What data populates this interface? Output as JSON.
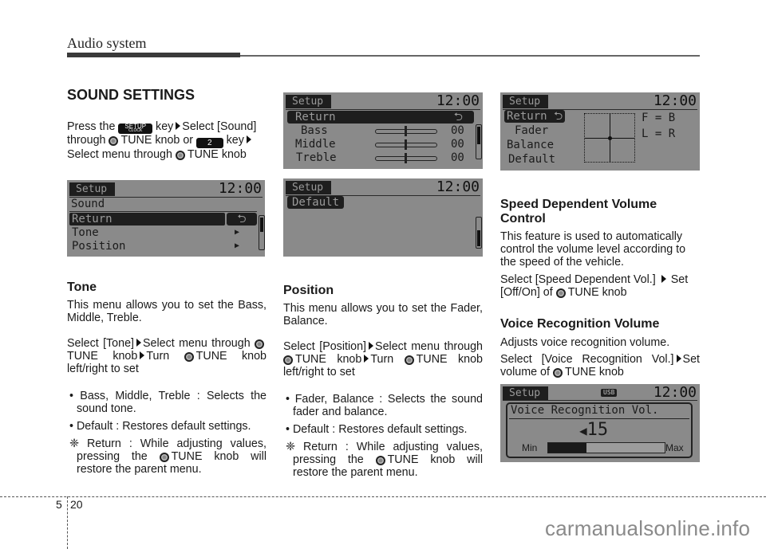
{
  "header": {
    "title": "Audio system"
  },
  "col1": {
    "heading": "SOUND SETTINGS",
    "intro": {
      "t1": "Press the",
      "key_setup": "SETUP",
      "key_setup_sub": "CLOCK",
      "t2": "key",
      "t3": "Select [Sound]",
      "t4": "through",
      "t5": "TUNE knob or",
      "key_2": "2",
      "t6": "key",
      "t7": "Select menu through",
      "t8": "TUNE knob"
    },
    "screen": {
      "tab": "Setup",
      "clock": "12:00",
      "title": "Sound",
      "items": [
        {
          "label": "Return",
          "icon": "return-icon",
          "selected": true
        },
        {
          "label": "Tone",
          "icon": "arrow-right-icon",
          "selected": false
        },
        {
          "label": "Position",
          "icon": "arrow-right-icon",
          "selected": false
        }
      ]
    },
    "tone": {
      "heading": "Tone",
      "desc": "This menu allows you to set the Bass, Middle, Treble.",
      "s1": "Select [Tone]",
      "s2": "Select menu through",
      "s3": "TUNE knob",
      "s4": "Turn",
      "s5": "TUNE knob left/right to set",
      "bullets": [
        "Bass, Middle, Treble : Selects the sound tone.",
        "Default : Restores default settings."
      ],
      "note_sym": "❈",
      "note1": "Return : While adjusting values, pressing the",
      "note2": "TUNE knob will restore the parent menu."
    }
  },
  "col2": {
    "screen_tone": {
      "tab": "Setup",
      "clock": "12:00",
      "return_label": "Return",
      "rows": [
        {
          "label": "Bass",
          "value": "00",
          "level": 0.5
        },
        {
          "label": "Middle",
          "value": "00",
          "level": 0.5
        },
        {
          "label": "Treble",
          "value": "00",
          "level": 0.5
        }
      ]
    },
    "screen_default": {
      "tab": "Setup",
      "clock": "12:00",
      "item": "Default"
    },
    "position": {
      "heading": "Position",
      "desc": "This menu allows you to set the Fader, Balance.",
      "s1": "Select [Position]",
      "s2": "Select menu through",
      "s3": "TUNE knob",
      "s4": "Turn",
      "s5": "TUNE knob left/right to set",
      "bullets": [
        "Fader, Balance : Selects the sound fader and balance.",
        "Default : Restores default settings."
      ],
      "note_sym": "❈",
      "note1": "Return : While adjusting values, pressing the",
      "note2": "TUNE knob will restore the parent menu."
    }
  },
  "col3": {
    "screen_position": {
      "tab": "Setup",
      "clock": "12:00",
      "items": [
        "Return",
        "Fader",
        "Balance",
        "Default"
      ],
      "fb": "F = B",
      "lr": "L = R"
    },
    "speed": {
      "heading": "Speed Dependent Volume Control",
      "desc": "This feature is used to automatically control the volume level according to the speed of the vehicle.",
      "s1": "Select [Speed Dependent Vol.]",
      "s2": "Set [Off/On] of",
      "s3": "TUNE knob"
    },
    "voice": {
      "heading": "Voice Recognition Volume",
      "desc": "Adjusts voice recognition volume.",
      "s1": "Select [Voice Recognition Vol.]",
      "s2": "Set volume of",
      "s3": "TUNE knob"
    },
    "screen_voice": {
      "tab": "Setup",
      "usb": "USB",
      "clock": "12:00",
      "title": "Voice Recognition Vol.",
      "value": "15",
      "min": "Min",
      "max": "Max",
      "level": 0.33
    }
  },
  "footer": {
    "chapter": "5",
    "page": "20",
    "watermark": "carmanualsonline.info"
  }
}
